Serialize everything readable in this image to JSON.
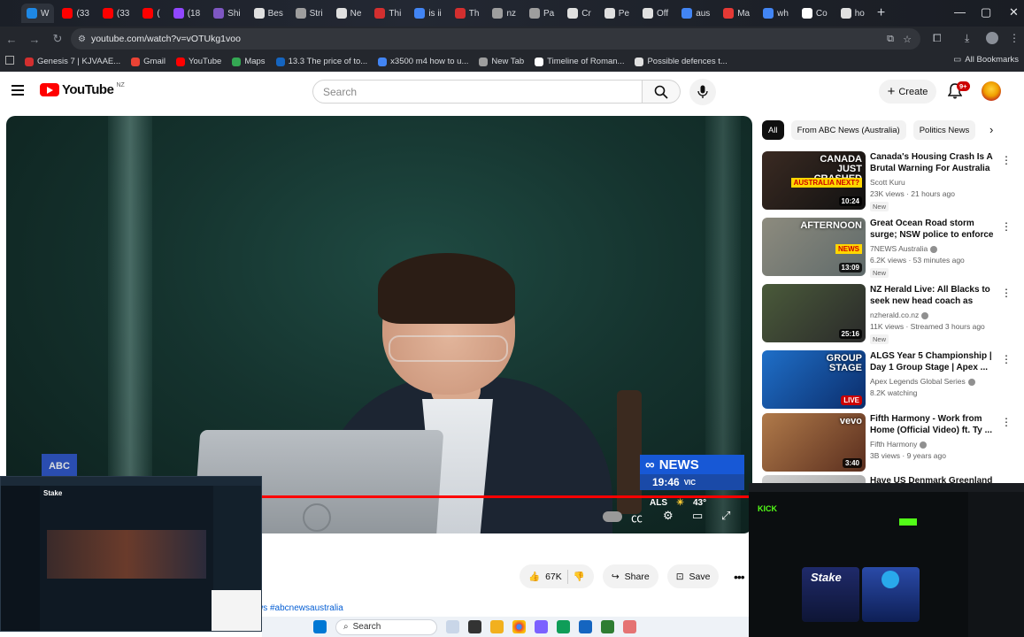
{
  "browser": {
    "tabs": [
      {
        "label": "W",
        "color": "#1e88e5"
      },
      {
        "label": "(33",
        "color": "#ff0000"
      },
      {
        "label": "(33",
        "color": "#ff0000"
      },
      {
        "label": "(",
        "color": "#ff0000"
      },
      {
        "label": "(18",
        "color": "#9147ff"
      },
      {
        "label": "Shi",
        "color": "#7e57c2"
      },
      {
        "label": "Bes",
        "color": "#e0e0e0"
      },
      {
        "label": "Stri",
        "color": "#9e9e9e"
      },
      {
        "label": "Ne",
        "color": "#e0e0e0"
      },
      {
        "label": "Thi",
        "color": "#d32f2f"
      },
      {
        "label": "is ii",
        "color": "#4285f4"
      },
      {
        "label": "Th",
        "color": "#d32f2f"
      },
      {
        "label": "nz",
        "color": "#9e9e9e"
      },
      {
        "label": "Pa",
        "color": "#9e9e9e"
      },
      {
        "label": "Cr",
        "color": "#e0e0e0"
      },
      {
        "label": "Pe",
        "color": "#e0e0e0"
      },
      {
        "label": "Off",
        "color": "#e0e0e0"
      },
      {
        "label": "aus",
        "color": "#4285f4"
      },
      {
        "label": "Ma",
        "color": "#e53935"
      },
      {
        "label": "wh",
        "color": "#4285f4"
      },
      {
        "label": "Co",
        "color": "#ffffff"
      },
      {
        "label": "ho",
        "color": "#e0e0e0"
      }
    ],
    "url": "youtube.com/watch?v=vOTUkg1voo",
    "bookmarks": [
      {
        "label": "Genesis 7 | KJVAAE...",
        "color": "#d32f2f"
      },
      {
        "label": "Gmail",
        "color": "#ea4335"
      },
      {
        "label": "YouTube",
        "color": "#ff0000"
      },
      {
        "label": "Maps",
        "color": "#34a853"
      },
      {
        "label": "13.3 The price of to...",
        "color": "#1565c0"
      },
      {
        "label": "x3500 m4 how to u...",
        "color": "#4285f4"
      },
      {
        "label": "New Tab",
        "color": "#9e9e9e"
      },
      {
        "label": "Timeline of Roman...",
        "color": "#ffffff"
      },
      {
        "label": "Possible defences t...",
        "color": "#e0e0e0"
      }
    ],
    "all_bookmarks": "All Bookmarks"
  },
  "masthead": {
    "logo_text": "YouTube",
    "country_code": "NZ",
    "search_placeholder": "Search",
    "create_label": "Create",
    "notification_badge": "9+"
  },
  "player": {
    "news_label": "NEWS",
    "time": "19:46",
    "state": "VIC",
    "weather_loc": "ALS",
    "temperature": "43°",
    "progress_color": "#ff0000"
  },
  "actions": {
    "likes": "67K",
    "share": "Share",
    "save": "Save"
  },
  "description_tags": "ws #abcnewsaustralia",
  "chips": [
    "All",
    "From ABC News (Australia)",
    "Politics News"
  ],
  "recommendations": [
    {
      "title": "Canada's Housing Crash Is A Brutal Warning For Australia ...",
      "channel": "Scott Kuru",
      "verified": false,
      "meta": "23K views · 21 hours ago",
      "badge": "New",
      "duration": "10:24",
      "thumb_text": "CANADA JUST CRASHED",
      "thumb_sub": "AUSTRALIA NEXT?",
      "thumb_colors": [
        "#3a2a22",
        "#111"
      ]
    },
    {
      "title": "Great Ocean Road storm surge; NSW police to enforce protest ...",
      "channel": "7NEWS Australia",
      "verified": true,
      "meta": "6.2K views · 53 minutes ago",
      "badge": "New",
      "duration": "13:09",
      "thumb_text": "AFTERNOON",
      "thumb_sub": "NEWS",
      "thumb_colors": [
        "#8d8b7e",
        "#5f6a6a"
      ]
    },
    {
      "title": "NZ Herald Live: All Blacks to seek new head coach as Scott...",
      "channel": "nzherald.co.nz",
      "verified": true,
      "meta": "11K views · Streamed 3 hours ago",
      "badge": "New",
      "duration": "25:16",
      "thumb_text": "",
      "thumb_sub": "",
      "thumb_colors": [
        "#4a5a3a",
        "#2a2a2a"
      ]
    },
    {
      "title": "ALGS Year 5 Championship | Day 1 Group Stage | Apex ...",
      "channel": "Apex Legends Global Series",
      "verified": true,
      "meta": "8.2K watching",
      "badge": "",
      "duration": "LIVE",
      "thumb_text": "GROUP STAGE",
      "thumb_sub": "",
      "thumb_colors": [
        "#1f6fc8",
        "#0b2d6b"
      ]
    },
    {
      "title": "Fifth Harmony - Work from Home (Official Video) ft. Ty ...",
      "channel": "Fifth Harmony",
      "verified": true,
      "meta": "3B views · 9 years ago",
      "badge": "",
      "duration": "3:40",
      "thumb_text": "vevo",
      "thumb_sub": "",
      "thumb_colors": [
        "#b07a4a",
        "#5a2e1e"
      ]
    },
    {
      "title": "Have US Denmark Greenland",
      "channel": "",
      "verified": false,
      "meta": "",
      "badge": "",
      "duration": "",
      "thumb_text": "",
      "thumb_sub": "",
      "thumb_colors": [
        "#d0d0d0",
        "#a0a0a0"
      ]
    }
  ],
  "overlays": {
    "stake_brand": "Stake",
    "kick_brand": "KICK",
    "kick_card_1": "Stake",
    "kick_card_2": "Telegram"
  },
  "taskbar": {
    "search_label": "Search"
  }
}
